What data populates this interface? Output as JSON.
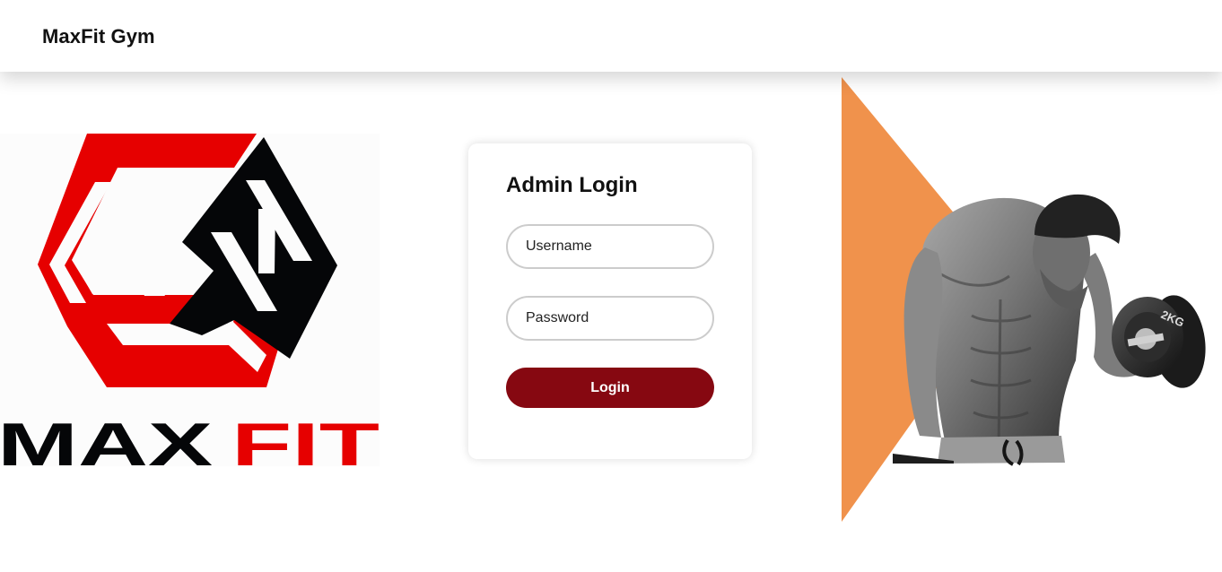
{
  "header": {
    "brand": "MaxFit Gym"
  },
  "logo": {
    "wordmark_left": "MAX",
    "wordmark_right": "FIT",
    "colors": {
      "red": "#e60000",
      "black": "#050608"
    }
  },
  "login": {
    "title": "Admin Login",
    "username_placeholder": "Username",
    "password_placeholder": "Password",
    "submit_label": "Login",
    "button_color": "#860811"
  },
  "hero": {
    "accent_color": "#f0924c",
    "dumbbell_plate_text": "2KG",
    "image_subject": "bodybuilder-curling-dumbbell"
  }
}
